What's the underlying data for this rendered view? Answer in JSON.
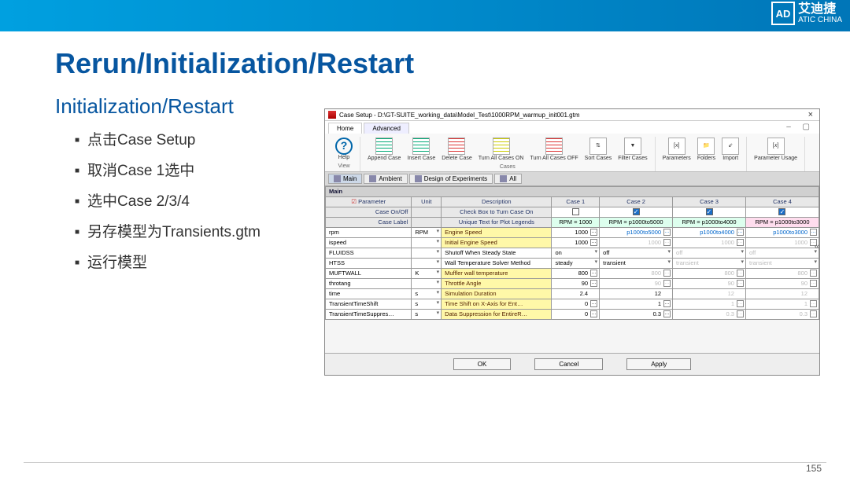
{
  "brand": {
    "name": "艾迪捷",
    "sub": "ATIC CHINA",
    "mark": "AD"
  },
  "slide_title": "Rerun/Initialization/Restart",
  "section_title": "Initialization/Restart",
  "bullets": [
    "点击Case Setup",
    "取消Case 1选中",
    "选中Case 2/3/4",
    "另存模型为Transients.gtm",
    "运行模型"
  ],
  "page_number": "155",
  "dialog": {
    "title": "Case Setup - D:\\GT-SUITE_working_data\\Model_Test\\1000RPM_warmup_init001.gtm",
    "tabs": [
      "Home",
      "Advanced"
    ],
    "ribbon": {
      "help": "Help",
      "view": "View",
      "cases_group": "Cases",
      "buttons": {
        "append": "Append\nCase",
        "insert": "Insert\nCase",
        "delete": "Delete\nCase",
        "allon": "Turn All\nCases ON",
        "alloff": "Turn All\nCases OFF",
        "sort": "Sort\nCases",
        "filter": "Filter\nCases",
        "params": "Parameters",
        "folders": "Folders",
        "import": "Import",
        "usage": "Parameter Usage"
      }
    },
    "subtabs": {
      "main": "Main",
      "ambient": "Ambient",
      "doe": "Design of Experiments",
      "all": "All"
    },
    "headers": {
      "param": "Parameter",
      "unit": "Unit",
      "desc": "Description",
      "c1": "Case 1",
      "c2": "Case 2",
      "c3": "Case 3",
      "c4": "Case 4"
    },
    "rows": {
      "onoff": {
        "label": "Case On/Off",
        "desc": "Check Box to Turn Case On"
      },
      "caselabel": {
        "label": "Case Label",
        "desc": "Unique Text for Plot Legends",
        "vals": [
          "RPM = 1000",
          "RPM = p1000to5000",
          "RPM = p1000to4000",
          "RPM = p1000to3000"
        ]
      },
      "rpm": {
        "p": "rpm",
        "u": "RPM",
        "d": "Engine Speed",
        "v": [
          "1000",
          "p1000to5000",
          "p1000to4000",
          "p1000to3000"
        ]
      },
      "ispd": {
        "p": "ispeed",
        "u": "",
        "d": "Initial Engine Speed",
        "v": [
          "1000",
          "1000",
          "1000",
          "1000"
        ]
      },
      "fluid": {
        "p": "FLUIDSS",
        "u": "",
        "d": "Shutoff When Steady State",
        "v": [
          "on",
          "off",
          "off",
          "off"
        ]
      },
      "htss": {
        "p": "HTSS",
        "u": "",
        "d": "Wall Temperature Solver Method",
        "v": [
          "steady",
          "transient",
          "transient",
          "transient"
        ]
      },
      "mufw": {
        "p": "MUFTWALL",
        "u": "K",
        "d": "Muffler wall temperature",
        "v": [
          "800",
          "800",
          "800",
          "800"
        ]
      },
      "thr": {
        "p": "throtang",
        "u": "",
        "d": "Throttle Angle",
        "v": [
          "90",
          "90",
          "90",
          "90"
        ]
      },
      "time": {
        "p": "time",
        "u": "s",
        "d": "Simulation Duration",
        "v": [
          "2.4",
          "12",
          "12",
          "12"
        ]
      },
      "ts": {
        "p": "TransientTimeShift",
        "u": "s",
        "d": "Time Shift on X-Axis for Ent…",
        "v": [
          "0",
          "1",
          "1",
          "1"
        ]
      },
      "sup": {
        "p": "TransientTimeSuppres…",
        "u": "s",
        "d": "Data Suppression for EntireR…",
        "v": [
          "0",
          "0.3",
          "0.3",
          "0.3"
        ]
      }
    },
    "actions": {
      "ok": "OK",
      "cancel": "Cancel",
      "apply": "Apply"
    }
  }
}
